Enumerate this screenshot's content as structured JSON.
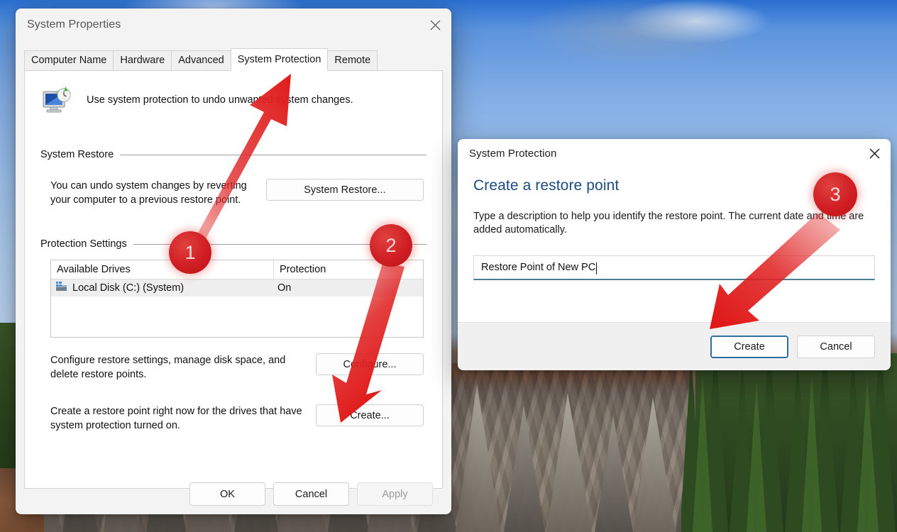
{
  "system_properties": {
    "title": "System Properties",
    "close_icon": "close-icon",
    "tabs": [
      {
        "label": "Computer Name",
        "active": false
      },
      {
        "label": "Hardware",
        "active": false
      },
      {
        "label": "Advanced",
        "active": false
      },
      {
        "label": "System Protection",
        "active": true
      },
      {
        "label": "Remote",
        "active": false
      }
    ],
    "intro": {
      "icon": "system-restore-icon",
      "text": "Use system protection to undo unwanted system changes."
    },
    "system_restore": {
      "group_label": "System Restore",
      "description": "You can undo system changes by reverting your computer to a previous restore point.",
      "button_label": "System Restore..."
    },
    "protection_settings": {
      "group_label": "Protection Settings",
      "columns": [
        "Available Drives",
        "Protection"
      ],
      "rows": [
        {
          "icon": "hard-disk-icon",
          "drive": "Local Disk (C:) (System)",
          "protection": "On"
        }
      ],
      "configure": {
        "description": "Configure restore settings, manage disk space, and delete restore points.",
        "button_label": "Configure..."
      },
      "create": {
        "description": "Create a restore point right now for the drives that have system protection turned on.",
        "button_label": "Create..."
      }
    },
    "footer": {
      "ok_label": "OK",
      "cancel_label": "Cancel",
      "apply_label": "Apply",
      "apply_disabled": true
    }
  },
  "system_protection_dialog": {
    "title": "System Protection",
    "close_icon": "close-icon",
    "heading": "Create a restore point",
    "description": "Type a description to help you identify the restore point. The current date and time are added automatically.",
    "input": {
      "value": "Restore Point of New PC",
      "placeholder": ""
    },
    "create_label": "Create",
    "cancel_label": "Cancel"
  },
  "annotations": {
    "badges": [
      {
        "number": "1"
      },
      {
        "number": "2"
      },
      {
        "number": "3"
      }
    ],
    "accent_color": "#cf1d22",
    "arrow_color": "#e23232"
  },
  "colors": {
    "dialog_heading": "#1b4b82",
    "focus_accent": "#2f6d9e",
    "window_bg": "#f3f3f3"
  }
}
